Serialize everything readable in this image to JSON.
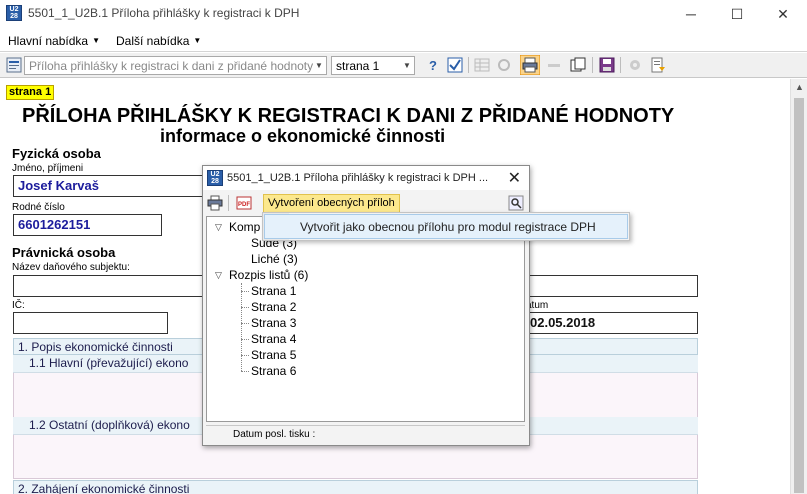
{
  "window": {
    "title": "5501_1_U2B.1 Příloha přihlášky k registraci k DPH",
    "minimize": "─",
    "maximize": "☐",
    "close": "✕"
  },
  "menubar": {
    "items": [
      {
        "label": "Hlavní nabídka"
      },
      {
        "label": "Další nabídka"
      }
    ]
  },
  "toolbar": {
    "form_combo": "Příloha přihlášky k registraci k dani z přidané hodnoty",
    "page_combo": "strana 1"
  },
  "page": {
    "tag": "strana 1",
    "heading1": "PŘÍLOHA PŘIHLÁŠKY K REGISTRACI K DANI Z PŘIDANÉ HODNOTY",
    "heading2": "informace o ekonomické činnosti",
    "fyzicka_osoba": "Fyzická osoba",
    "jmeno_label": "Jméno, příjmeni",
    "jmeno_value": "Josef Karvaš",
    "rodne_cislo_label": "Rodné číslo",
    "rodne_cislo_value": "6601262151",
    "pravnicka_osoba": "Právnická osoba",
    "nazev_label": "Název daňového subjektu:",
    "nazev_value": "",
    "ic_label": "IČ:",
    "ic_value": "",
    "datum_label": "atum",
    "datum_value": "02.05.2018",
    "section1": "1. Popis ekonomické činnosti",
    "sub11": "1.1 Hlavní (převažující) ekono",
    "sub12": "1.2 Ostatní (doplňková) ekono",
    "section2": "2. Zahájení ekonomické činnosti"
  },
  "dialog": {
    "title": "5501_1_U2B.1 Příloha přihlášky k registraci k DPH ...",
    "close": "✕",
    "create_button": "Vytvoření obecných příloh",
    "tree": {
      "root1": "Komp",
      "sude": "Sudé (3)",
      "liche": "Liché (3)",
      "root2": "Rozpis listů (6)",
      "pages": [
        "Strana 1",
        "Strana 2",
        "Strana 3",
        "Strana 4",
        "Strana 5",
        "Strana 6"
      ]
    },
    "status_label": "Datum posl. tisku :"
  },
  "dropdown": {
    "item": "Vytvořit jako obecnou přílohu pro modul registrace DPH"
  },
  "colors": {
    "highlight_yellow": "#ffff00",
    "button_highlight": "#fce88d",
    "section_bg": "#eaf3f8",
    "value_text": "#1c1c9c"
  }
}
